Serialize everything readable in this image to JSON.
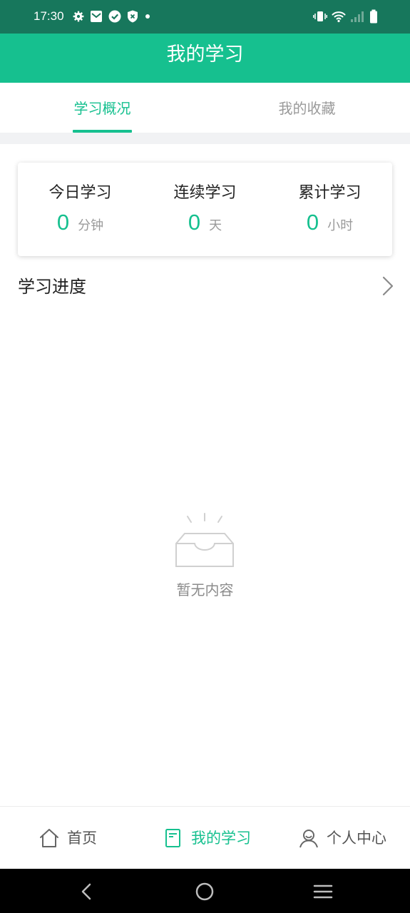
{
  "status_bar": {
    "time": "17:30",
    "bg_color": "#17775c",
    "left_icons": [
      "gear-icon",
      "email-icon",
      "check-circle-icon",
      "shield-icon",
      "dot-icon"
    ],
    "right_icons": [
      "vibrate-icon",
      "wifi-icon",
      "signal-icon",
      "battery-icon"
    ]
  },
  "header": {
    "title": "我的学习",
    "accent_color": "#16c08f"
  },
  "tabs": [
    {
      "label": "学习概况",
      "active": true
    },
    {
      "label": "我的收藏",
      "active": false
    }
  ],
  "stats": [
    {
      "label": "今日学习",
      "value": "0",
      "unit": "分钟"
    },
    {
      "label": "连续学习",
      "value": "0",
      "unit": "天"
    },
    {
      "label": "累计学习",
      "value": "0",
      "unit": "小时"
    }
  ],
  "progress": {
    "title": "学习进度"
  },
  "empty_state": {
    "icon": "empty-inbox-icon",
    "text": "暂无内容"
  },
  "bottom_nav": [
    {
      "label": "首页",
      "icon": "home-icon",
      "active": false
    },
    {
      "label": "我的学习",
      "icon": "book-icon",
      "active": true
    },
    {
      "label": "个人中心",
      "icon": "user-icon",
      "active": false
    }
  ],
  "system_nav": [
    "back-icon",
    "home-circle-icon",
    "menu-icon"
  ]
}
